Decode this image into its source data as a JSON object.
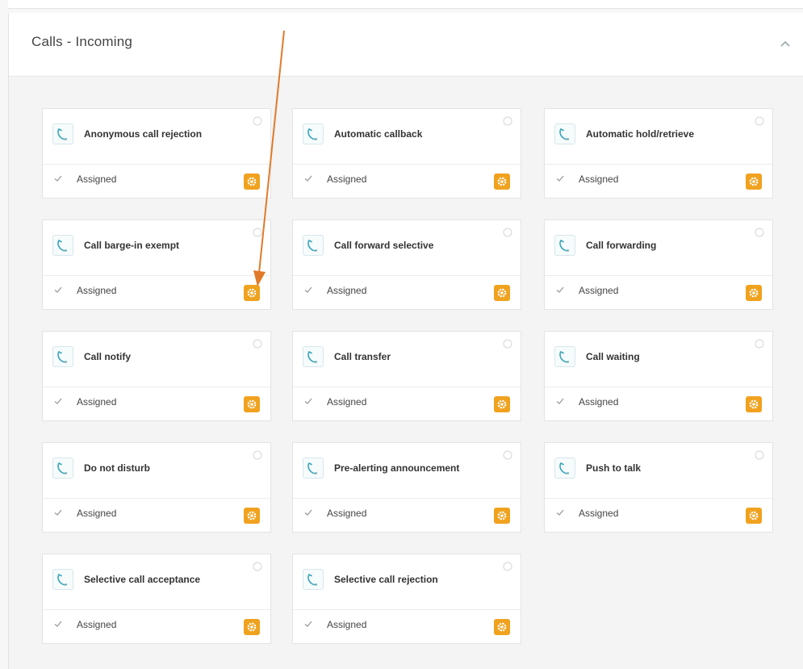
{
  "section": {
    "title": "Calls - Incoming"
  },
  "colors": {
    "accent": "#f0a21f",
    "phone_icon": "#3aa6b9",
    "annotation_arrow": "#e07a2a"
  },
  "icons": {
    "card_icon": "phone-handset-icon",
    "status_icon": "checkmark-icon",
    "action_icon": "gear-icon",
    "info_icon": "info-icon",
    "collapse_icon": "chevron-up-icon"
  },
  "cards": [
    {
      "title": "Anonymous call rejection",
      "status": "Assigned"
    },
    {
      "title": "Automatic callback",
      "status": "Assigned"
    },
    {
      "title": "Automatic hold/retrieve",
      "status": "Assigned"
    },
    {
      "title": "Call barge-in exempt",
      "status": "Assigned"
    },
    {
      "title": "Call forward selective",
      "status": "Assigned"
    },
    {
      "title": "Call forwarding",
      "status": "Assigned"
    },
    {
      "title": "Call notify",
      "status": "Assigned"
    },
    {
      "title": "Call transfer",
      "status": "Assigned"
    },
    {
      "title": "Call waiting",
      "status": "Assigned"
    },
    {
      "title": "Do not disturb",
      "status": "Assigned"
    },
    {
      "title": "Pre-alerting announcement",
      "status": "Assigned"
    },
    {
      "title": "Push to talk",
      "status": "Assigned"
    },
    {
      "title": "Selective call acceptance",
      "status": "Assigned"
    },
    {
      "title": "Selective call rejection",
      "status": "Assigned"
    }
  ]
}
